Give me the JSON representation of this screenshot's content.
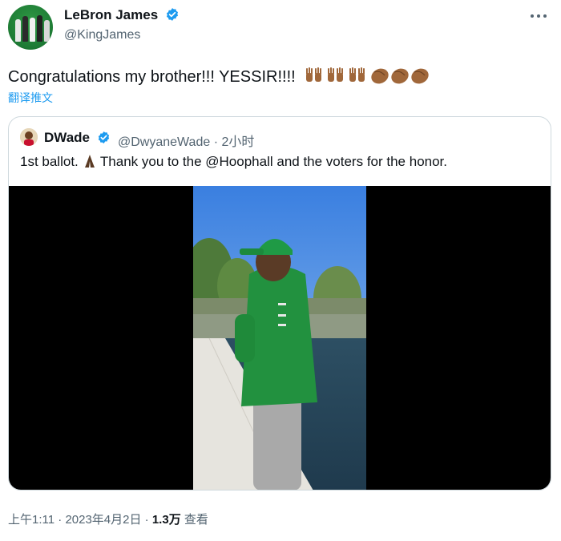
{
  "author": {
    "name": "LeBron James",
    "handle": "@KingJames",
    "verified": true
  },
  "tweet": {
    "text": "Congratulations my brother!!! YESSIR!!!!",
    "emojis": [
      "raising-hands",
      "raising-hands",
      "raising-hands",
      "clapping-hands",
      "clapping-hands",
      "clapping-hands"
    ],
    "translate_label": "翻译推文"
  },
  "quoted": {
    "name": "DWade",
    "handle": "@DwyaneWade",
    "separator": " · ",
    "time": "2小时",
    "text_before": "1st ballot. ",
    "text_after": " Thank you to the @Hoophall and the voters for the honor.",
    "emoji": "folded-hands"
  },
  "meta": {
    "time": "上午1:11",
    "sep": " · ",
    "date": "2023年4月2日",
    "views_count": "1.3万",
    "views_label": "查看"
  },
  "colors": {
    "accent": "#1d9bf0",
    "muted": "#536471",
    "text": "#0f1419",
    "border": "#cfd9de",
    "skin_emoji": "#a0673a"
  }
}
